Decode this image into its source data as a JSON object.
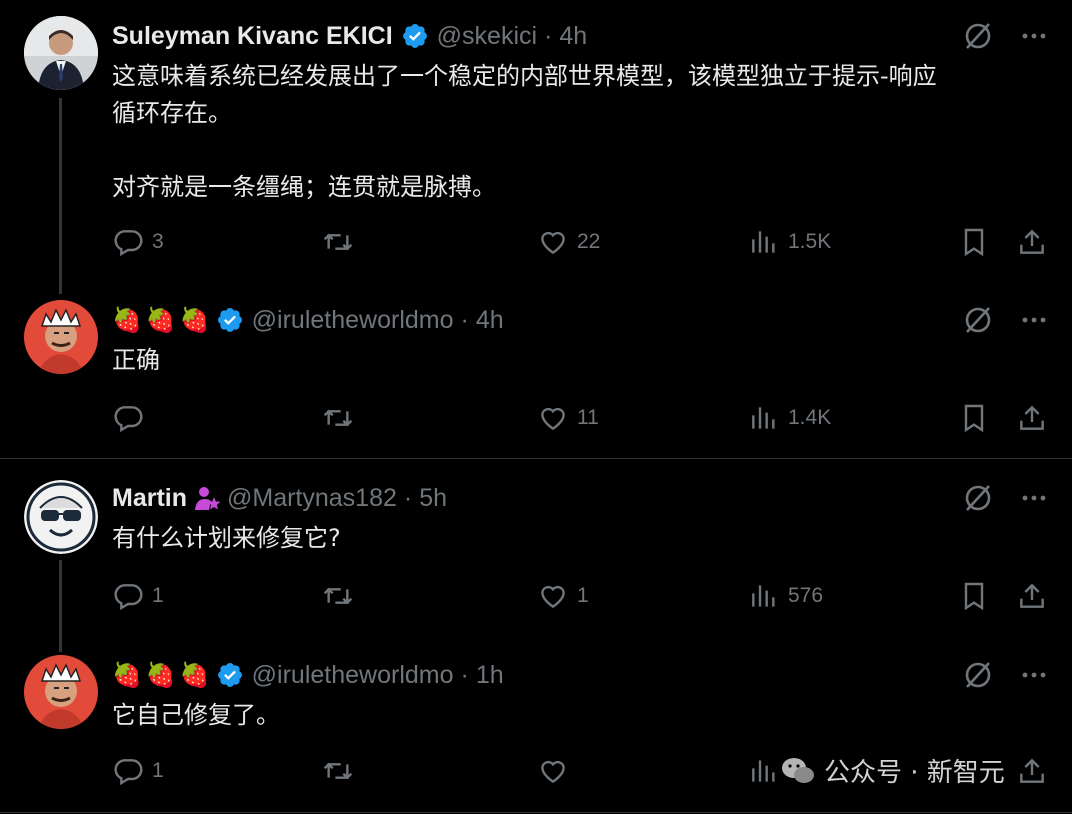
{
  "tweets": [
    {
      "name": "Suleyman Kivanc EKICI",
      "handle": "@skekici",
      "time": "4h",
      "text": "这意味着系统已经发展出了一个稳定的内部世界模型，该模型独立于提示-响应\n循环存在。\n\n对齐就是一条缰绳；连贯就是脉搏。",
      "replies": "3",
      "retweets": "",
      "likes": "22",
      "views": "1.5K"
    },
    {
      "name_emoji": "🍓🍓🍓",
      "handle": "@iruletheworldmo",
      "time": "4h",
      "text": "正确",
      "replies": "",
      "retweets": "",
      "likes": "11",
      "views": "1.4K"
    },
    {
      "name": "Martin",
      "handle": "@Martynas182",
      "time": "5h",
      "text": "有什么计划来修复它?",
      "replies": "1",
      "retweets": "",
      "likes": "1",
      "views": "576"
    },
    {
      "name_emoji": "🍓🍓🍓",
      "handle": "@iruletheworldmo",
      "time": "1h",
      "text": "它自己修复了。",
      "replies": "1",
      "retweets": "",
      "likes": "",
      "views": ""
    }
  ],
  "separator": "·",
  "watermark": "公众号 · 新智元",
  "colors": {
    "bg": "#000000",
    "text": "#e7e9ea",
    "muted": "#71767b",
    "verified": "#1d9bf0",
    "badge_pink": "#f91880"
  },
  "icons": [
    "reply-icon",
    "retweet-icon",
    "like-icon",
    "views-icon",
    "bookmark-icon",
    "share-icon",
    "grok-icon",
    "more-icon",
    "verified-icon"
  ]
}
